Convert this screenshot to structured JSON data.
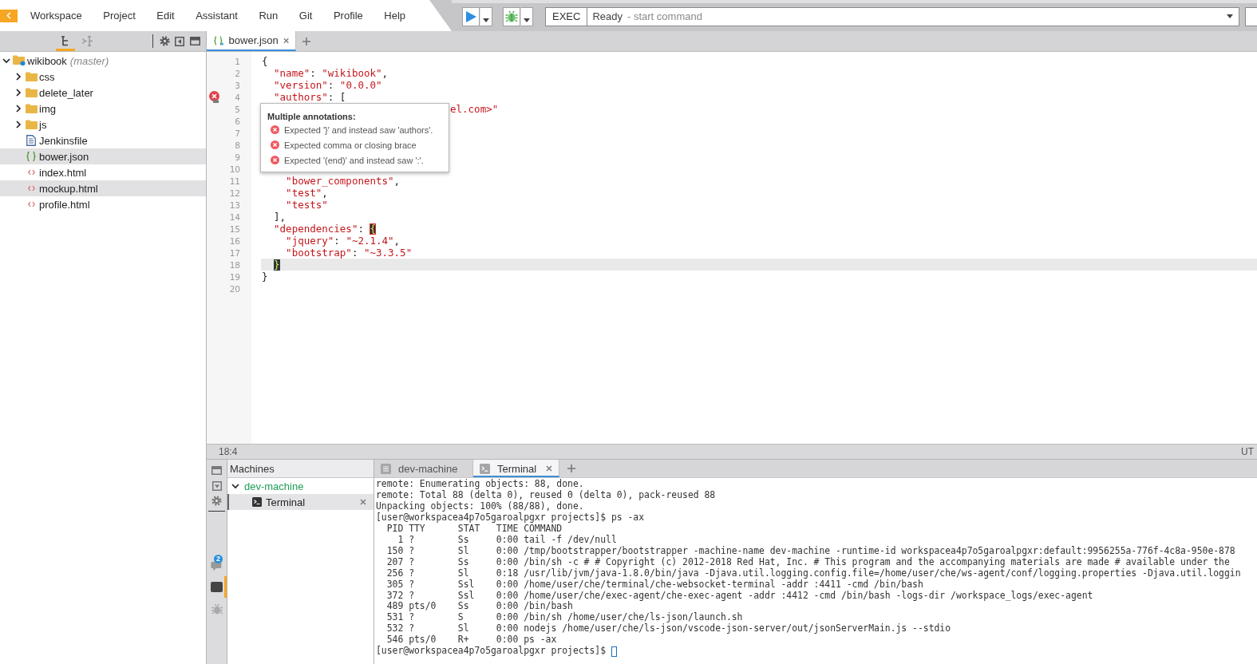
{
  "top_bar": {
    "menu": [
      "Workspace",
      "Project",
      "Edit",
      "Assistant",
      "Run",
      "Git",
      "Profile",
      "Help"
    ],
    "command": {
      "label": "EXEC",
      "status": "Ready",
      "hint": "- start command"
    }
  },
  "sidebar": {
    "tabs": [
      {
        "kind": "tree",
        "selected": true
      },
      {
        "kind": "structure",
        "selected": false
      }
    ],
    "project": {
      "name": "wikibook",
      "branch": "(master)",
      "expanded": true,
      "children": [
        {
          "name": "css",
          "kind": "folder",
          "expanded": false,
          "selected": false
        },
        {
          "name": "delete_later",
          "kind": "folder",
          "expanded": false,
          "selected": false
        },
        {
          "name": "img",
          "kind": "folder",
          "expanded": false,
          "selected": false
        },
        {
          "name": "js",
          "kind": "folder",
          "expanded": false,
          "selected": false
        },
        {
          "name": "Jenkinsfile",
          "kind": "text",
          "selected": false
        },
        {
          "name": "bower.json",
          "kind": "json",
          "selected": true
        },
        {
          "name": "index.html",
          "kind": "html",
          "selected": false
        },
        {
          "name": "mockup.html",
          "kind": "html",
          "selected": true
        },
        {
          "name": "profile.html",
          "kind": "html",
          "selected": false
        }
      ]
    }
  },
  "editor": {
    "tabs": [
      {
        "label": "bower.json",
        "kind": "json",
        "selected": true,
        "closable": true
      }
    ],
    "lines": [
      {
        "number": "1",
        "text": "{",
        "error": false,
        "current": false
      },
      {
        "number": "2",
        "text": "  \"name\": \"wikibook\",",
        "error": false,
        "current": false
      },
      {
        "number": "3",
        "text": "  \"version\": \"0.0.0\"",
        "error": false,
        "current": false
      },
      {
        "number": "4",
        "text": "  \"authors\": [",
        "error": true,
        "current": false
      },
      {
        "number": "5",
        "text": "el.com>\"",
        "hidden_start": true,
        "error": false,
        "current": false
      },
      {
        "number": "6",
        "error": false,
        "current": false
      },
      {
        "number": "7",
        "error": false,
        "current": false
      },
      {
        "number": "8",
        "error": false,
        "current": false
      },
      {
        "number": "9",
        "error": false,
        "current": false
      },
      {
        "number": "10",
        "error": false,
        "current": false
      },
      {
        "number": "11",
        "text": "    \"bower_components\",",
        "error": false,
        "current": false
      },
      {
        "number": "12",
        "text": "    \"test\",",
        "error": false,
        "current": false
      },
      {
        "number": "13",
        "text": "    \"tests\"",
        "error": false,
        "current": false
      },
      {
        "number": "14",
        "text": "  ],",
        "error": false,
        "current": false
      },
      {
        "number": "15",
        "text": "  \"dependencies\": {",
        "bracket": true,
        "error": false,
        "current": false
      },
      {
        "number": "16",
        "text": "    \"jquery\": \"~2.1.4\",",
        "error": false,
        "current": false
      },
      {
        "number": "17",
        "text": "    \"bootstrap\": \"~3.3.5\"",
        "error": false,
        "current": false
      },
      {
        "number": "18",
        "text": "  }",
        "bracket": true,
        "error": false,
        "current": true
      },
      {
        "number": "19",
        "text": "}",
        "error": false,
        "current": false
      },
      {
        "number": "20",
        "error": false,
        "current": false
      }
    ],
    "annotations": {
      "title": "Multiple annotations:",
      "messages": [
        "Expected '}' and instead saw 'authors'.",
        "Expected comma or closing brace",
        "Expected '(end)' and instead saw ':'."
      ]
    }
  },
  "status_bar": {
    "cursor": "18:4",
    "encoding": "UT"
  },
  "bottom_panel": {
    "side_tabs": [
      {
        "kind": "events",
        "badge": "2",
        "selected": false
      },
      {
        "kind": "processes",
        "selected": true
      },
      {
        "kind": "debug",
        "selected": false
      }
    ],
    "machines": {
      "title": "Machines",
      "items": [
        {
          "name": "dev-machine",
          "expanded": true,
          "children": [
            {
              "name": "Terminal",
              "selected": true,
              "closable": true
            }
          ]
        }
      ]
    },
    "console_tabs": [
      {
        "label": "dev-machine",
        "kind": "output",
        "selected": false,
        "closable": false
      },
      {
        "label": "Terminal",
        "kind": "terminal",
        "selected": true,
        "closable": true
      }
    ],
    "terminal": {
      "cursor": true,
      "lines": [
        "remote: Enumerating objects: 88, done.",
        "remote: Total 88 (delta 0), reused 0 (delta 0), pack-reused 88",
        "Unpacking objects: 100% (88/88), done.",
        "[user@workspacea4p7o5garoalpgxr projects]$ ps -ax",
        "  PID TTY      STAT   TIME COMMAND",
        "    1 ?        Ss     0:00 tail -f /dev/null",
        "  150 ?        Sl     0:00 /tmp/bootstrapper/bootstrapper -machine-name dev-machine -runtime-id workspacea4p7o5garoalpgxr:default:9956255a-776f-4c8a-950e-878",
        "  207 ?        Ss     0:00 /bin/sh -c # # Copyright (c) 2012-2018 Red Hat, Inc. # This program and the accompanying materials are made # available under the",
        "  256 ?        Sl     0:18 /usr/lib/jvm/java-1.8.0/bin/java -Djava.util.logging.config.file=/home/user/che/ws-agent/conf/logging.properties -Djava.util.loggin",
        "  305 ?        Ssl    0:00 /home/user/che/terminal/che-websocket-terminal -addr :4411 -cmd /bin/bash",
        "  372 ?        Ssl    0:00 /home/user/che/exec-agent/che-exec-agent -addr :4412 -cmd /bin/bash -logs-dir /workspace_logs/exec-agent",
        "  489 pts/0    Ss     0:00 /bin/bash",
        "  531 ?        S      0:00 /bin/sh /home/user/che/ls-json/launch.sh",
        "  532 ?        Sl     0:00 nodejs /home/user/che/ls-json/vscode-json-server/out/jsonServerMain.js --stdio",
        "  546 pts/0    R+     0:00 ps -ax",
        "[user@workspacea4p7o5garoalpgxr projects]$"
      ]
    }
  }
}
